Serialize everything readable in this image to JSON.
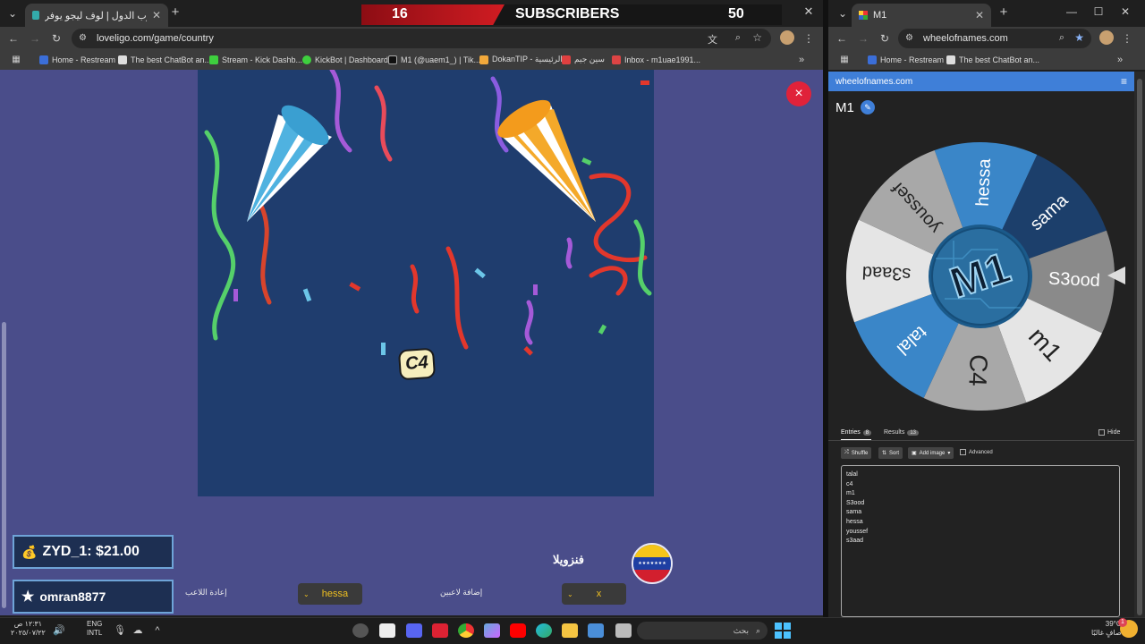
{
  "overlay": {
    "left_count": "16",
    "label": "SUBSCRIBERS",
    "right_count": "50"
  },
  "left_browser": {
    "tab_title": "لعبة حرب الدول | لوف ليجو يوفر",
    "url": "loveligo.com/game/country",
    "bookmarks": [
      "Home - Restream",
      "The best ChatBot an...",
      "Stream - Kick Dashb...",
      "KickBot | Dashboard",
      "M1 (@uaem1_) | Tik...",
      "DokanTIP - الرئيسية",
      "سين جيم",
      "Inbox - m1uae1991..."
    ]
  },
  "game": {
    "close_label": "×",
    "winner_label": "C4",
    "country_name": "فنزويلا",
    "donation_badge": "ZYD_1: $21.00",
    "follower_badge": "omran8877",
    "replay_label": "إعادة اللاعب",
    "player_select": "hessa",
    "add_players_label": "إضافة لاعبين",
    "x_select": "x"
  },
  "right_browser": {
    "tab_title": "M1",
    "url": "wheelofnames.com",
    "bookmarks": [
      "Home - Restream",
      "The best ChatBot an..."
    ],
    "site_name": "wheelofnames.com",
    "wheel_title": "M1",
    "wheel_center_logo": "M1",
    "wheel_segments": [
      {
        "name": "hessa",
        "color": "#3a86c8"
      },
      {
        "name": "sama",
        "color": "#1c3f6b"
      },
      {
        "name": "S3ood",
        "color": "#8a8a8a"
      },
      {
        "name": "m1",
        "color": "#e5e5e5"
      },
      {
        "name": "C4",
        "color": "#a8a8a8"
      },
      {
        "name": "talal",
        "color": "#3a86c8"
      },
      {
        "name": "s3aad",
        "color": "#e5e5e5"
      },
      {
        "name": "youssef",
        "color": "#a8a8a8"
      }
    ],
    "tabs": {
      "entries": "Entries",
      "entries_count": "8",
      "results": "Results",
      "results_count": "13"
    },
    "hide_label": "Hide",
    "toolbar": {
      "shuffle": "Shuffle",
      "sort": "Sort",
      "add_image": "Add image",
      "advanced": "Advanced"
    },
    "entries": [
      "talal",
      "c4",
      "m1",
      "S3ood",
      "sama",
      "hessa",
      "youssef",
      "s3aad"
    ]
  },
  "taskbar": {
    "time": "١٢:٣١ ص",
    "date": "٢٠٢٥/٠٧/٢٢",
    "lang1": "ENG",
    "lang2": "INTL",
    "search_placeholder": "بحث",
    "temp": "39°C",
    "weather": "صافٍ غالبًا",
    "notif": "1"
  }
}
